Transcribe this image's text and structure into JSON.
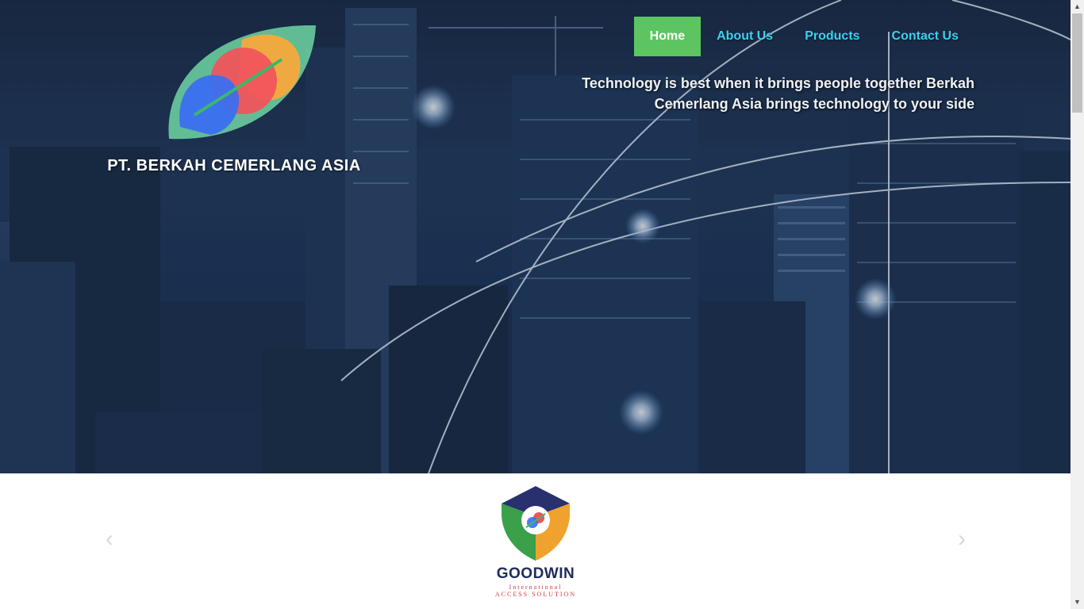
{
  "header": {
    "company_name": "PT. BERKAH CEMERLANG ASIA",
    "tagline": "Technology is best when it brings people together Berkah Cemerlang Asia brings technology to your side"
  },
  "nav": {
    "items": [
      {
        "label": "Home",
        "active": true
      },
      {
        "label": "About Us",
        "active": false
      },
      {
        "label": "Products",
        "active": false
      },
      {
        "label": "Contact Us",
        "active": false
      }
    ],
    "active_color": "#5cc561",
    "link_color": "#3bd1f0"
  },
  "carousel": {
    "prev_icon": "chevron-left-icon",
    "next_icon": "chevron-right-icon",
    "slide": {
      "name": "GOODWIN",
      "subtitle_line1": "International",
      "subtitle_line2": "access solution"
    }
  }
}
